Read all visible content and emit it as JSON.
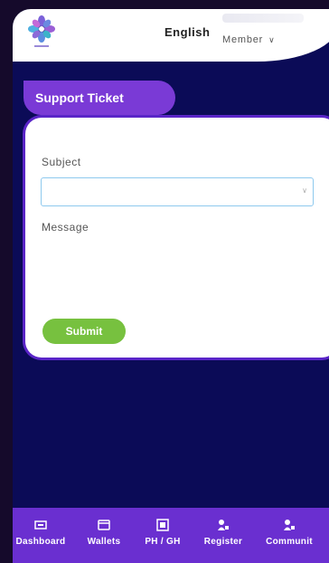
{
  "header": {
    "language": "English",
    "member_label": "Member",
    "logo_icon": "flower-logo-icon"
  },
  "ticket": {
    "title": "Support Ticket"
  },
  "form": {
    "subject_label": "Subject",
    "subject_value": "",
    "message_label": "Message",
    "message_value": "",
    "submit_label": "Submit"
  },
  "nav": {
    "items": [
      {
        "label": "Dashboard",
        "icon": "dashboard-icon"
      },
      {
        "label": "Wallets",
        "icon": "wallet-icon"
      },
      {
        "label": "PH / GH",
        "icon": "ph-gh-icon"
      },
      {
        "label": "Register",
        "icon": "register-icon"
      },
      {
        "label": "Communit",
        "icon": "community-icon"
      }
    ]
  },
  "colors": {
    "background": "#0b0b57",
    "accent_purple": "#7a3ad6",
    "nav_purple": "#6a2fd0",
    "submit_green": "#77c13f"
  }
}
